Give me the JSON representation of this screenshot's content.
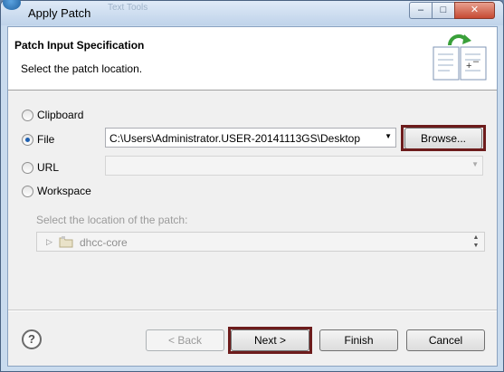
{
  "window": {
    "title": "Apply Patch",
    "ghost_tab": "Text Tools",
    "minimize": "–",
    "maximize": "□",
    "close": "✕"
  },
  "header": {
    "title": "Patch Input Specification",
    "description": "Select the patch location."
  },
  "sources": {
    "clipboard_label": "Clipboard",
    "file_label": "File",
    "url_label": "URL",
    "workspace_label": "Workspace",
    "selected": "File"
  },
  "file": {
    "path": "C:\\Users\\Administrator.USER-20141113GS\\Desktop",
    "browse_label": "Browse..."
  },
  "url": {
    "value": ""
  },
  "workspace": {
    "prompt": "Select the location of the patch:",
    "tree_item": "dhcc-core"
  },
  "footer": {
    "help_label": "?",
    "back_label": "< Back",
    "next_label": "Next >",
    "finish_label": "Finish",
    "cancel_label": "Cancel"
  },
  "icons": {
    "app": "eclipse-logo-icon",
    "header": "apply-patch-wizard-icon",
    "tree_item": "project-folder-icon"
  },
  "colors": {
    "highlight": "#6d1c1c",
    "radio_dot": "#1d5fb0"
  }
}
